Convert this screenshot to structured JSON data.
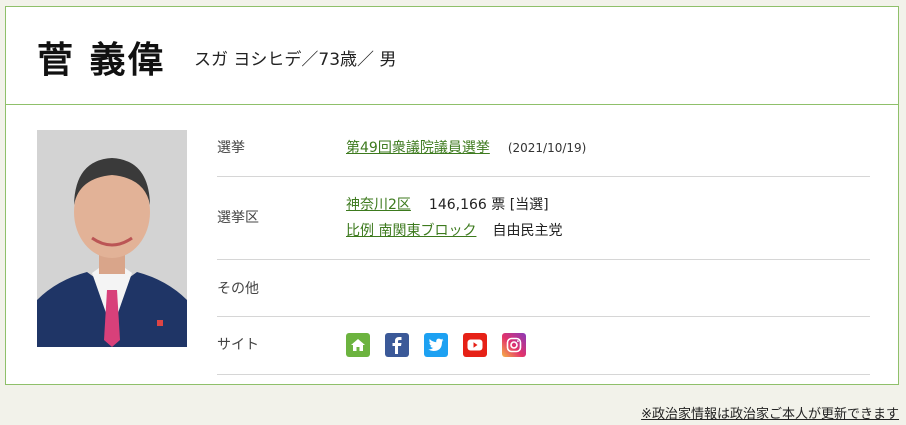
{
  "profile": {
    "name": "菅 義偉",
    "kana_age_gender": "スガ ヨシヒデ／73歳／ 男"
  },
  "rows": {
    "election": {
      "label": "選挙",
      "election_link": "第49回衆議院議員選挙",
      "date": "(2021/10/19)"
    },
    "district": {
      "label": "選挙区",
      "district_link": "神奈川2区",
      "votes": "146,166 票 [当選]",
      "proportional_link": "比例 南関東ブロック",
      "party": "自由民主党"
    },
    "other": {
      "label": "その他"
    },
    "site": {
      "label": "サイト",
      "icons": [
        "home-icon",
        "facebook-icon",
        "twitter-icon",
        "youtube-icon",
        "instagram-icon"
      ]
    }
  },
  "colors": {
    "accent_border": "#8fc06a",
    "link": "#3d7a1e",
    "home": "#6cb33f",
    "facebook": "#3b5998",
    "twitter": "#1da1f2",
    "youtube": "#e62117"
  },
  "footer": {
    "note": "※政治家情報は政治家ご本人が更新できます"
  }
}
